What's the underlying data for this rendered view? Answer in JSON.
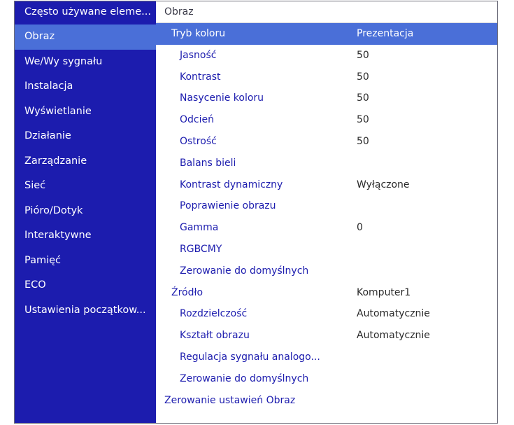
{
  "sidebar": {
    "items": [
      {
        "label": "Często używane eleme...",
        "name": "sidebar-item-czesto-uzywane"
      },
      {
        "label": "Obraz",
        "name": "sidebar-item-obraz"
      },
      {
        "label": "We/Wy sygnału",
        "name": "sidebar-item-we-wy-sygnalu"
      },
      {
        "label": "Instalacja",
        "name": "sidebar-item-instalacja"
      },
      {
        "label": "Wyświetlanie",
        "name": "sidebar-item-wyswietlanie"
      },
      {
        "label": "Działanie",
        "name": "sidebar-item-dzialanie"
      },
      {
        "label": "Zarządzanie",
        "name": "sidebar-item-zarzadzanie"
      },
      {
        "label": "Sieć",
        "name": "sidebar-item-siec"
      },
      {
        "label": "Pióro/Dotyk",
        "name": "sidebar-item-pioro-dotyk"
      },
      {
        "label": "Interaktywne",
        "name": "sidebar-item-interaktywne"
      },
      {
        "label": "Pamięć",
        "name": "sidebar-item-pamiec"
      },
      {
        "label": "ECO",
        "name": "sidebar-item-eco"
      },
      {
        "label": "Ustawienia początkow...",
        "name": "sidebar-item-ustawienia-poczatkowe"
      }
    ],
    "active_index": 1
  },
  "panel": {
    "title": "Obraz",
    "rows": [
      {
        "label": "Tryb koloru",
        "value": "Prezentacja",
        "level": 1,
        "selected": true
      },
      {
        "label": "Jasność",
        "value": "50",
        "level": 2
      },
      {
        "label": "Kontrast",
        "value": "50",
        "level": 2
      },
      {
        "label": "Nasycenie koloru",
        "value": "50",
        "level": 2
      },
      {
        "label": "Odcień",
        "value": "50",
        "level": 2
      },
      {
        "label": "Ostrość",
        "value": "50",
        "level": 2
      },
      {
        "label": "Balans bieli",
        "value": "",
        "level": 2
      },
      {
        "label": "Kontrast dynamiczny",
        "value": "Wyłączone",
        "level": 2
      },
      {
        "label": "Poprawienie obrazu",
        "value": "",
        "level": 2
      },
      {
        "label": "Gamma",
        "value": "0",
        "level": 2
      },
      {
        "label": "RGBCMY",
        "value": "",
        "level": 2
      },
      {
        "label": "Zerowanie do domyślnych",
        "value": "",
        "level": 2
      },
      {
        "label": "Źródło",
        "value": "Komputer1",
        "level": 1
      },
      {
        "label": "Rozdzielczość",
        "value": "Automatycznie",
        "level": 2
      },
      {
        "label": "Kształt obrazu",
        "value": "Automatycznie",
        "level": 2
      },
      {
        "label": "Regulacja sygnału analogo...",
        "value": "",
        "level": 2
      },
      {
        "label": "Zerowanie do domyślnych",
        "value": "",
        "level": 2
      },
      {
        "label": "Zerowanie ustawień Obraz",
        "value": "",
        "level": 0
      }
    ]
  },
  "colors": {
    "sidebar_bg": "#1c1cae",
    "highlight": "#4a6fd8",
    "item_text": "#1c1cae",
    "value_text": "#2a2a2a"
  }
}
